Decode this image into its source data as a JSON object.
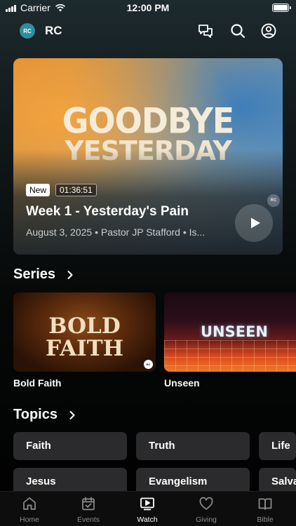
{
  "status_bar": {
    "carrier": "Carrier",
    "time": "12:00 PM"
  },
  "header": {
    "logo_text": "RC",
    "title": "RC",
    "icons": [
      "chat-bubbles-icon",
      "search-icon",
      "profile-icon"
    ]
  },
  "hero": {
    "art_line1": "GOODBYE",
    "art_line2": "YESTERDAY",
    "badge_new": "New",
    "duration": "01:36:51",
    "title": "Week 1 - Yesterday's Pain",
    "meta": "August 3, 2025 • Pastor JP Stafford • Is..."
  },
  "series": {
    "heading": "Series",
    "items": [
      {
        "name": "Bold Faith",
        "art_line1": "BOLD",
        "art_line2": "FAITH"
      },
      {
        "name": "Unseen",
        "art_text": "UNSEEN"
      }
    ]
  },
  "topics": {
    "heading": "Topics",
    "row1": [
      "Faith",
      "Truth",
      "Life"
    ],
    "row2": [
      "Jesus",
      "Evangelism",
      "Salva"
    ]
  },
  "tabs": [
    {
      "label": "Home",
      "icon": "home-icon"
    },
    {
      "label": "Events",
      "icon": "calendar-icon"
    },
    {
      "label": "Watch",
      "icon": "play-screen-icon",
      "active": true
    },
    {
      "label": "Giving",
      "icon": "heart-icon"
    },
    {
      "label": "Bible",
      "icon": "book-icon"
    }
  ],
  "colors": {
    "accent": "#2d8fa0",
    "tab_inactive": "#8e8e90",
    "topic_bg": "#2b2b2d"
  }
}
